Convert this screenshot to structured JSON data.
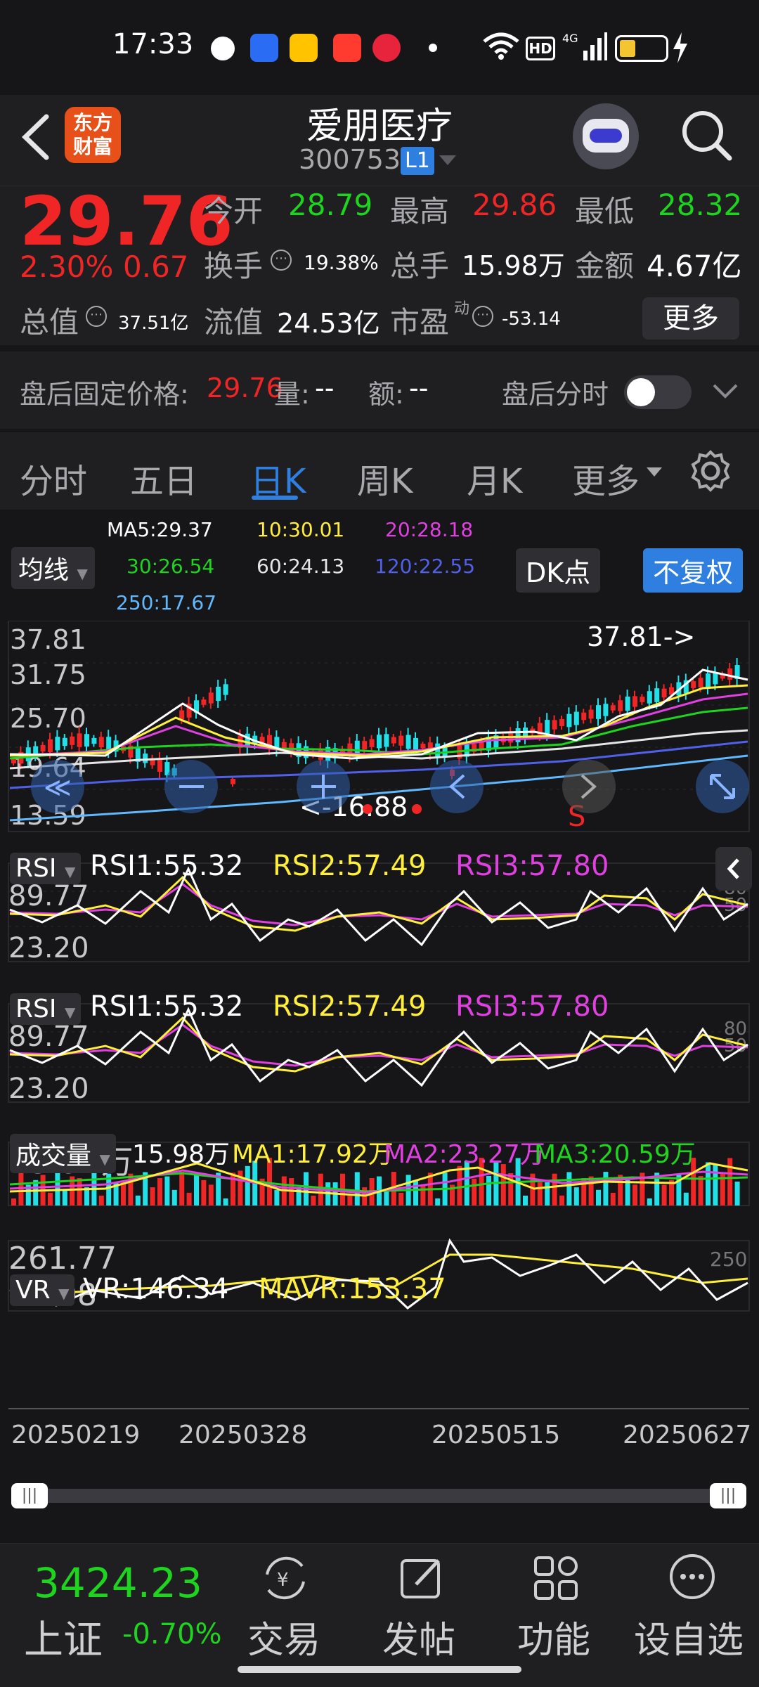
{
  "status": {
    "time": "17:33",
    "net": "4G"
  },
  "header": {
    "brand": "东方财富",
    "title": "爱朋医疗",
    "code": "300753",
    "level": "L1"
  },
  "quote": {
    "price": "29.76",
    "pct": "2.30%",
    "chg": "0.67",
    "open_label": "今开",
    "open": "28.79",
    "high_label": "最高",
    "high": "29.86",
    "low_label": "最低",
    "low": "28.32",
    "turnover_label": "换手",
    "turnover": "19.38%",
    "vol_label": "总手",
    "vol": "15.98万",
    "amount_label": "金额",
    "amount": "4.67亿",
    "cap_label": "总值",
    "cap": "37.51亿",
    "float_label": "流值",
    "float": "24.53亿",
    "pe_label": "市盈",
    "pe_sup": "动",
    "pe": "-53.14",
    "more": "更多"
  },
  "afterhours": {
    "price_label": "盘后固定价格:",
    "price": "29.76",
    "vol_label": "量:",
    "vol": "--",
    "amt_label": "额:",
    "amt": "--",
    "toggle_label": "盘后分时"
  },
  "tabs": [
    "分时",
    "五日",
    "日K",
    "周K",
    "月K",
    "更多"
  ],
  "ma": {
    "selector": "均线",
    "dk": "DK点",
    "fq": "不复权",
    "ma5": "MA5:29.37",
    "ma10": "10:30.01",
    "ma20": "20:28.18",
    "ma30": "30:26.54",
    "ma60": "60:24.13",
    "ma120": "120:22.55",
    "ma250": "250:17.67"
  },
  "kline": {
    "yticks": [
      "37.81",
      "31.75",
      "25.70",
      "19.64",
      "13.59"
    ],
    "max_label": "37.81->",
    "min_label": "<-16.88",
    "s_mark": "S"
  },
  "rsi": {
    "selector": "RSI",
    "rsi1": "RSI1:55.32",
    "rsi2": "RSI2:57.49",
    "rsi3": "RSI3:57.80",
    "top": "89.77",
    "bottom": "23.20",
    "r80": "80",
    "r50": "50"
  },
  "volume": {
    "selector": "成交量",
    "v": "15.98万",
    "ma1": "MA1:17.92万",
    "ma2": "MA2:23.27万",
    "ma3": "MA3:20.59万",
    "top": "45.91万"
  },
  "vr": {
    "selector": "VR",
    "vr": "VR:146.34",
    "mavr": "MAVR:153.37",
    "top": "261.77",
    "bottom": "89.08",
    "r250": "250"
  },
  "dates": [
    "20250219",
    "20250328",
    "20250515",
    "20250627"
  ],
  "bottom": {
    "index_value": "3424.23",
    "index_name": "上证",
    "index_pct": "-0.70%",
    "nav": [
      "交易",
      "发帖",
      "功能",
      "设自选"
    ]
  },
  "colors": {
    "up": "#f02525",
    "down": "#1fd41f",
    "accent": "#2f7fe0"
  }
}
